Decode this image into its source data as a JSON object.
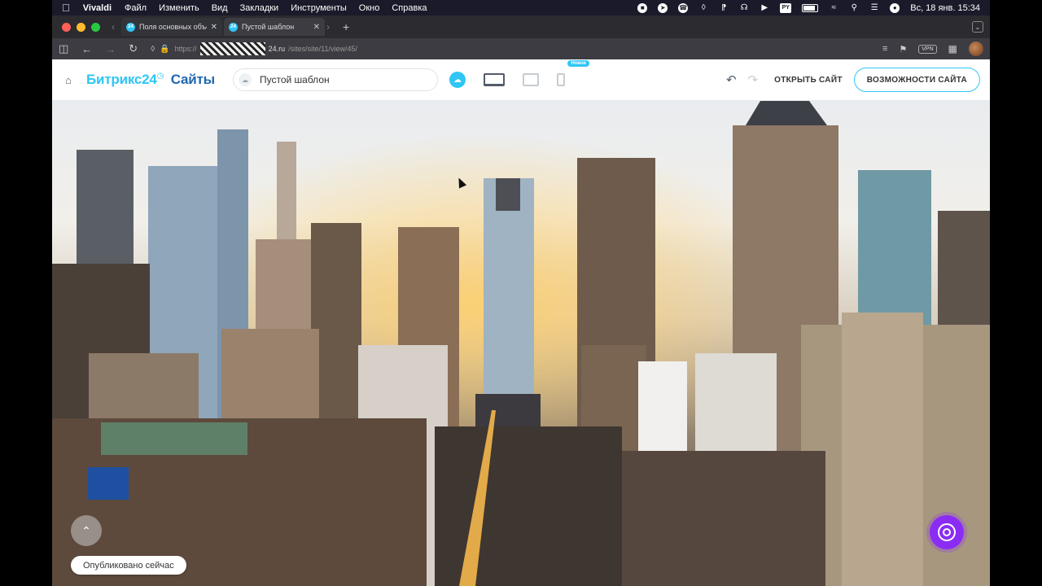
{
  "menubar": {
    "app": "Vivaldi",
    "items": [
      "Файл",
      "Изменить",
      "Вид",
      "Закладки",
      "Инструменты",
      "Окно",
      "Справка"
    ],
    "clock": "Вс, 18 янв.  15:34",
    "lang": "PY"
  },
  "tabs": [
    {
      "label": "Поля основных объек",
      "active": false
    },
    {
      "label": "Пустой шаблон",
      "active": true
    }
  ],
  "address": {
    "prefix": "https://",
    "host": "24.ru",
    "path": "/sites/site/11/view/45/",
    "vpn": "VPN"
  },
  "header": {
    "logo_main": "Битрикс24",
    "logo_sub": "Сайты",
    "page_name": "Пустой шаблон",
    "new_badge": "Новое",
    "open_site": "ОТКРЫТЬ САЙТ",
    "features": "ВОЗМОЖНОСТИ САЙТА"
  },
  "status": {
    "published": "Опубликовано сейчас"
  },
  "colors": {
    "accent": "#2fc6f6",
    "brand_dark": "#2067b0",
    "widget": "#8b2cf5"
  }
}
